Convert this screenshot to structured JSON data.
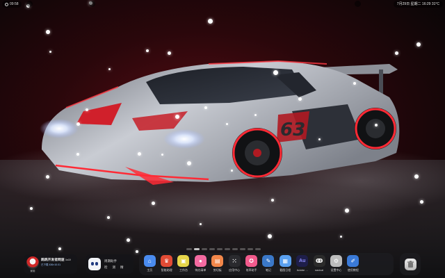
{
  "topbar": {
    "left_time": "09:58",
    "right_text": "7月29日 星期二 16:29 31°C"
  },
  "widgets": {
    "user": {
      "name": "跳跳开发者网速",
      "tag": "1s10",
      "stats": "已下载 436×10.01",
      "avatar_label": "家用"
    },
    "robot": {
      "row1": [
        "周期助手"
      ],
      "row2": [
        "检",
        "测",
        "精"
      ]
    }
  },
  "dock": {
    "items": [
      {
        "label": "主页",
        "icon": "home-icon",
        "color": "#4a8cf0",
        "glyph": "⌂"
      },
      {
        "label": "智能助理",
        "icon": "crown-icon",
        "color": "#e14b35",
        "glyph": "♛"
      },
      {
        "label": "工作台",
        "icon": "workspace-icon",
        "color": "#e6d54a",
        "glyph": "▣"
      },
      {
        "label": "待办清单",
        "icon": "tomato-icon",
        "color": "#f46aa0",
        "glyph": "●"
      },
      {
        "label": "剪切板",
        "icon": "clipboard-icon",
        "color": "#f2874a",
        "glyph": "▤"
      },
      {
        "label": "应用中心",
        "icon": "apps-grid-icon",
        "color": "#2a2a2e",
        "glyph": "⁙"
      },
      {
        "label": "效率助手",
        "icon": "app-store-icon",
        "color": "#f25a8c",
        "glyph": "✪"
      },
      {
        "label": "笔记",
        "icon": "note-icon",
        "color": "#3a78c8",
        "glyph": "✎"
      },
      {
        "label": "截图日程",
        "icon": "calendar-icon",
        "color": "#5aa0f0",
        "glyph": "▦"
      },
      {
        "label": "Adobe ...",
        "icon": "adobe-audition-icon",
        "color": "#1e1e4a",
        "glyph": "Au"
      },
      {
        "label": "navicat",
        "icon": "navicat-icon",
        "color": "#2b2b2b",
        "glyph": "ↂ"
      },
      {
        "label": "设置中心",
        "icon": "settings-icon",
        "color": "#bdbdbd",
        "glyph": "⚙"
      },
      {
        "label": "使用教程",
        "icon": "tutorial-icon",
        "color": "#3a7ad8",
        "glyph": "✐"
      }
    ],
    "trash": {
      "icon": "trash-icon"
    }
  },
  "colors": {
    "accent_red": "#e0202a",
    "dock_bg": "#1c1c20"
  }
}
